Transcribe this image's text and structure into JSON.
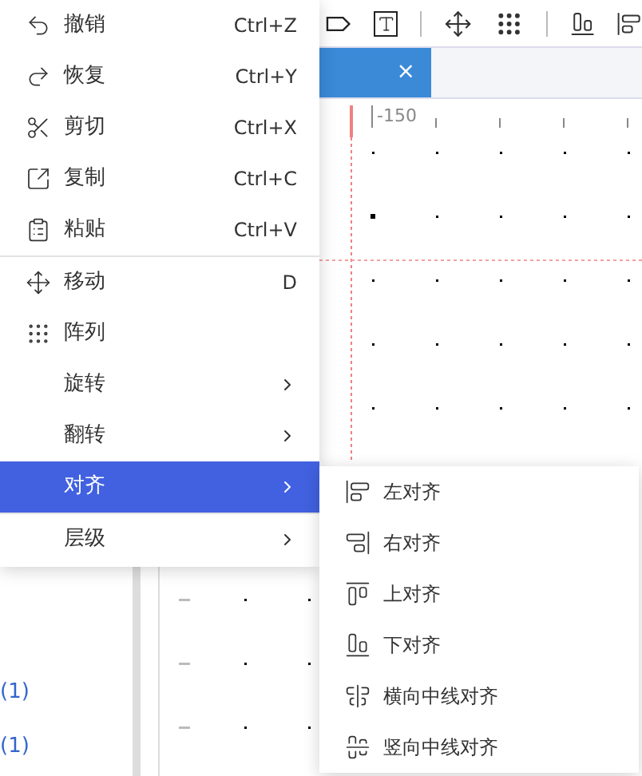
{
  "tab": {
    "close": "×",
    "selected": true
  },
  "ruler": {
    "label": "-150"
  },
  "sidebar": {
    "items": [
      "(1)",
      "(1)"
    ]
  },
  "context_menu": {
    "groups": [
      [
        {
          "label": "撤销",
          "shortcut": "Ctrl+Z",
          "submenu": false,
          "selected": false
        },
        {
          "label": "恢复",
          "shortcut": "Ctrl+Y",
          "submenu": false,
          "selected": false
        },
        {
          "label": "剪切",
          "shortcut": "Ctrl+X",
          "submenu": false,
          "selected": false
        },
        {
          "label": "复制",
          "shortcut": "Ctrl+C",
          "submenu": false,
          "selected": false
        },
        {
          "label": "粘贴",
          "shortcut": "Ctrl+V",
          "submenu": false,
          "selected": false
        }
      ],
      [
        {
          "label": "移动",
          "shortcut": "D",
          "submenu": false,
          "selected": false
        },
        {
          "label": "阵列",
          "submenu": false,
          "selected": false
        },
        {
          "label": "旋转",
          "submenu": true,
          "selected": false
        },
        {
          "label": "翻转",
          "submenu": true,
          "selected": false
        },
        {
          "label": "对齐",
          "submenu": true,
          "selected": true
        }
      ],
      [
        {
          "label": "层级",
          "submenu": true,
          "selected": false
        }
      ]
    ]
  },
  "align_submenu": {
    "items": [
      {
        "label": "左对齐"
      },
      {
        "label": "右对齐"
      },
      {
        "label": "上对齐"
      },
      {
        "label": "下对齐"
      },
      {
        "label": "横向中线对齐"
      },
      {
        "label": "竖向中线对齐"
      }
    ]
  }
}
